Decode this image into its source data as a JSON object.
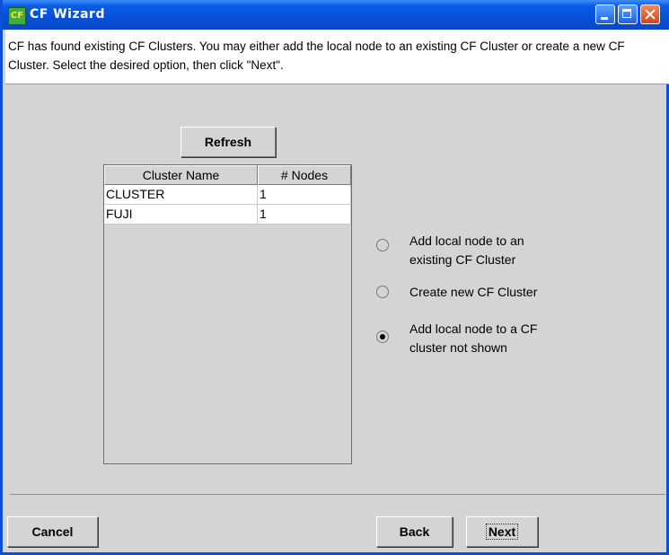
{
  "window": {
    "title": "CF Wizard",
    "icon_text": "CF",
    "controls": [
      "minimize-icon",
      "maximize-icon",
      "close-icon"
    ]
  },
  "header": {
    "message": "CF has found existing CF Clusters. You may either add the local node to an existing CF Cluster or create a new CF Cluster. Select the desired option, then click \"Next\"."
  },
  "clusters": {
    "refresh_label": "Refresh",
    "columns": [
      "Cluster Name",
      "# Nodes"
    ],
    "rows": [
      {
        "name": "CLUSTER",
        "nodes": "1"
      },
      {
        "name": "FUJI",
        "nodes": "1"
      }
    ]
  },
  "options": [
    {
      "label": "Add local node to an existing CF Cluster",
      "selected": false
    },
    {
      "label": "Create new CF Cluster",
      "selected": false
    },
    {
      "label": "Add local node to a CF cluster not shown",
      "selected": true
    }
  ],
  "footer": {
    "cancel_label": "Cancel",
    "back_label": "Back",
    "next_label": "Next"
  },
  "colors": {
    "titlebar": "#0650d8",
    "background": "#d4d4d4",
    "close_button": "#d1441c"
  }
}
